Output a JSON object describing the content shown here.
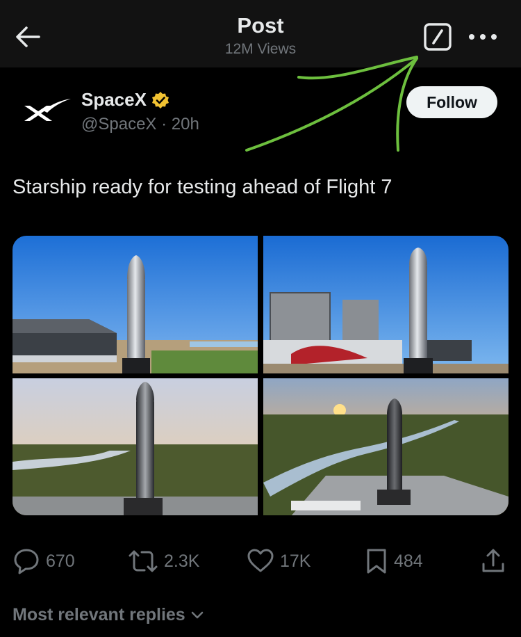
{
  "header": {
    "title": "Post",
    "views": "12M Views",
    "icons": [
      "back-arrow-icon",
      "grok-icon",
      "more-icon"
    ]
  },
  "author": {
    "name": "SpaceX",
    "handle": "@SpaceX · 20h",
    "verified": true,
    "badge_color": "#f1c232",
    "follow_label": "Follow"
  },
  "post": {
    "text": "Starship ready for testing ahead of Flight 7",
    "media_count": 4
  },
  "actions": {
    "replies": "670",
    "reposts": "2.3K",
    "likes": "17K",
    "bookmarks": "484"
  },
  "replies_sort": {
    "label": "Most relevant replies"
  },
  "colors": {
    "background": "#000000",
    "header_bg": "#121212",
    "text_primary": "#e7e9ea",
    "text_secondary": "#71767b",
    "annotation": "#6dbf3e"
  }
}
